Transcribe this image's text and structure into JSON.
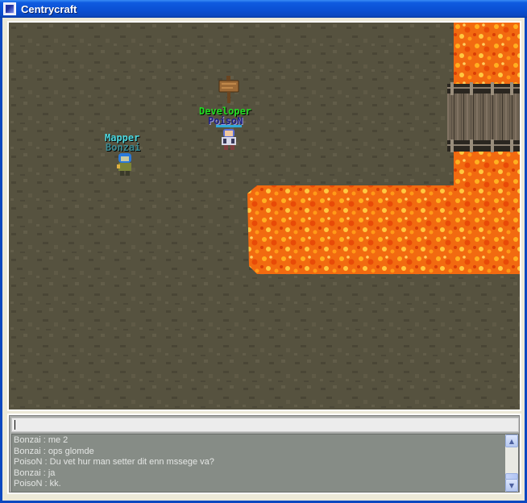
{
  "window": {
    "title": "Centrycraft",
    "icon": "app-icon"
  },
  "game": {
    "players": [
      {
        "rank": "Developer",
        "name": "PoisoN",
        "rank_color": "#22DD22",
        "name_color": "#202080"
      },
      {
        "rank": "Mapper",
        "name": "Bonzai",
        "rank_color": "#4CD8E0",
        "name_color": "#3C8C94"
      }
    ],
    "objects": [
      "signpost",
      "wooden-bridge",
      "lava-pool"
    ],
    "colors": {
      "ground": "#56523f",
      "lava": "#F26A10",
      "bridge": "#6E6252"
    }
  },
  "chat": {
    "input_value": "",
    "messages": [
      {
        "sender": "Bonzai",
        "text": "me 2"
      },
      {
        "sender": "Bonzai",
        "text": "ops glomde"
      },
      {
        "sender": "PoisoN",
        "text": "Du vet hur man setter dit enn mssege va?"
      },
      {
        "sender": "Bonzai",
        "text": "ja"
      },
      {
        "sender": "PoisoN",
        "text": "kk."
      }
    ]
  }
}
